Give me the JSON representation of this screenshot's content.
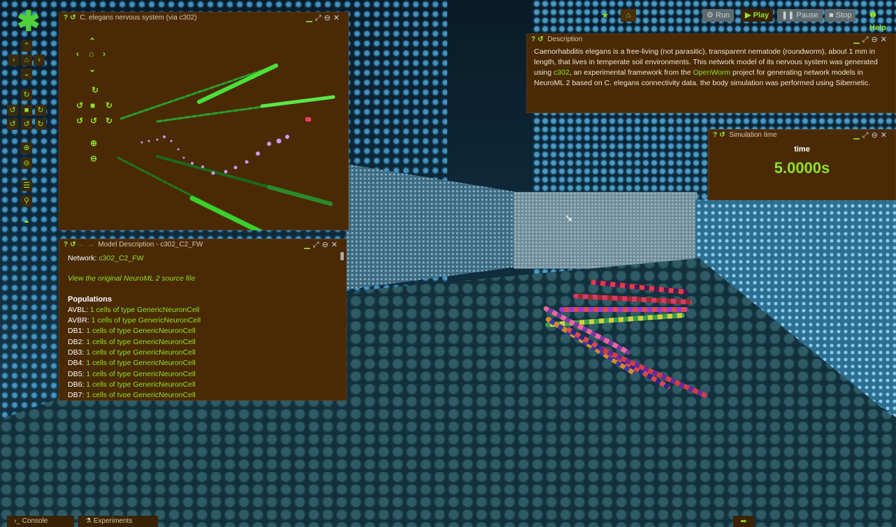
{
  "logo": {
    "glyph": "✱"
  },
  "top_toolbar": {
    "run_label": "Run",
    "play_label": "Play",
    "pause_label": "Pause",
    "stop_label": "Stop",
    "help_label": "Help"
  },
  "network_panel": {
    "title": "C. elegans nervous system (via c302)"
  },
  "description_panel": {
    "title": "Description",
    "text_1": "Caenorhabditis elegans is a free-living (not parasitic), transparent nematode (roundworm), about 1 mm in length, that lives in temperate soil environments. This network model of its nervous system was generated using ",
    "link_1": "c302",
    "text_2": ", an experimental framework from the ",
    "link_2": "OpenWorm",
    "text_3": " project for generating network models in NeuroML 2 based on C. elegans connectivity data. the body simulation was performed using Sibernetic."
  },
  "sim_time_panel": {
    "title": "Simulation time",
    "label": "time",
    "value": "5.0000s"
  },
  "model_panel": {
    "title": "Model Description - c302_C2_FW",
    "network_label": "Network:",
    "network_value": "c302_C2_FW",
    "source_link": "View the original NeuroML 2 source file",
    "populations_heading": "Populations",
    "populations": [
      {
        "name": "AVBL:",
        "desc": "1 cells of type GenericNeuronCell"
      },
      {
        "name": "AVBR:",
        "desc": "1 cells of type GenericNeuronCell"
      },
      {
        "name": "DB1:",
        "desc": "1 cells of type GenericNeuronCell"
      },
      {
        "name": "DB2:",
        "desc": "1 cells of type GenericNeuronCell"
      },
      {
        "name": "DB3:",
        "desc": "1 cells of type GenericNeuronCell"
      },
      {
        "name": "DB4:",
        "desc": "1 cells of type GenericNeuronCell"
      },
      {
        "name": "DB5:",
        "desc": "1 cells of type GenericNeuronCell"
      },
      {
        "name": "DB6:",
        "desc": "1 cells of type GenericNeuronCell"
      },
      {
        "name": "DB7:",
        "desc": "1 cells of type GenericNeuronCell"
      }
    ]
  },
  "bottom_bar": {
    "console_label": "Console",
    "experiments_label": "Experiments"
  },
  "colors": {
    "accent_green": "#8fe02e",
    "panel_brown": "#4a2a05"
  }
}
